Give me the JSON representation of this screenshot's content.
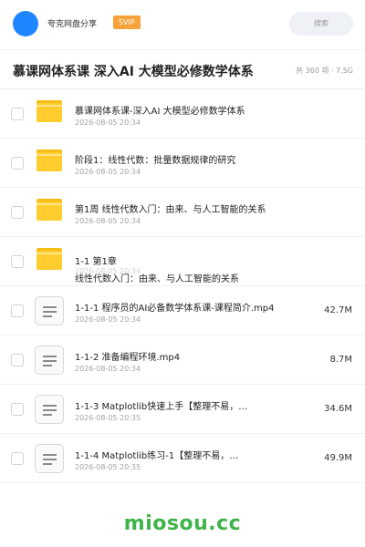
{
  "header": {
    "app_name": "夸克网盘分享",
    "badge": "SVIP",
    "search_label": "搜索",
    "accent_color": "#1f86ff"
  },
  "title_bar": {
    "title": "慕课网体系课 深入AI 大模型必修数学体系",
    "count_info": "共 360 项 · 7.5G"
  },
  "files": [
    {
      "type": "folder",
      "icon": "folder-icon",
      "name": "慕课网体系课-深入AI 大模型必修数学体系",
      "date": "2026-08-05 20:34",
      "size": ""
    },
    {
      "type": "folder",
      "icon": "folder-icon",
      "name": "阶段1：线性代数：批量数据规律的研究",
      "date": "2026-08-05 20:34",
      "size": ""
    },
    {
      "type": "folder",
      "icon": "folder-icon",
      "name": "第1周 线性代数入门：由来、与人工智能的关系",
      "date": "2026-08-05 20:34",
      "size": ""
    },
    {
      "type": "folder",
      "icon": "folder-icon",
      "name": "1-1 第1章",
      "name_line2": "线性代数入门：由来、与人工智能的关系",
      "date": "2026-08-05 20:34",
      "size": ""
    },
    {
      "type": "document",
      "icon": "document-icon",
      "name": "1-1-1 程序员的AI必备数学体系课-课程简介.mp4",
      "date": "2026-08-05 20:34",
      "size": "42.7M"
    },
    {
      "type": "document",
      "icon": "document-icon",
      "name": "1-1-2 准备编程环境.mp4",
      "date": "2026-08-05 20:34",
      "size": "8.7M"
    },
    {
      "type": "document",
      "icon": "document-icon",
      "name": "1-1-3 Matplotlib快速上手【整理不易，更多课程…",
      "date": "2026-08-05 20:35",
      "size": "34.6M"
    },
    {
      "type": "document",
      "icon": "document-icon",
      "name": "1-1-4 Matplotlib练习-1【整理不易，更多课程…",
      "date": "2026-08-05 20:35",
      "size": "49.9M"
    }
  ],
  "watermark": "miosou.cc"
}
